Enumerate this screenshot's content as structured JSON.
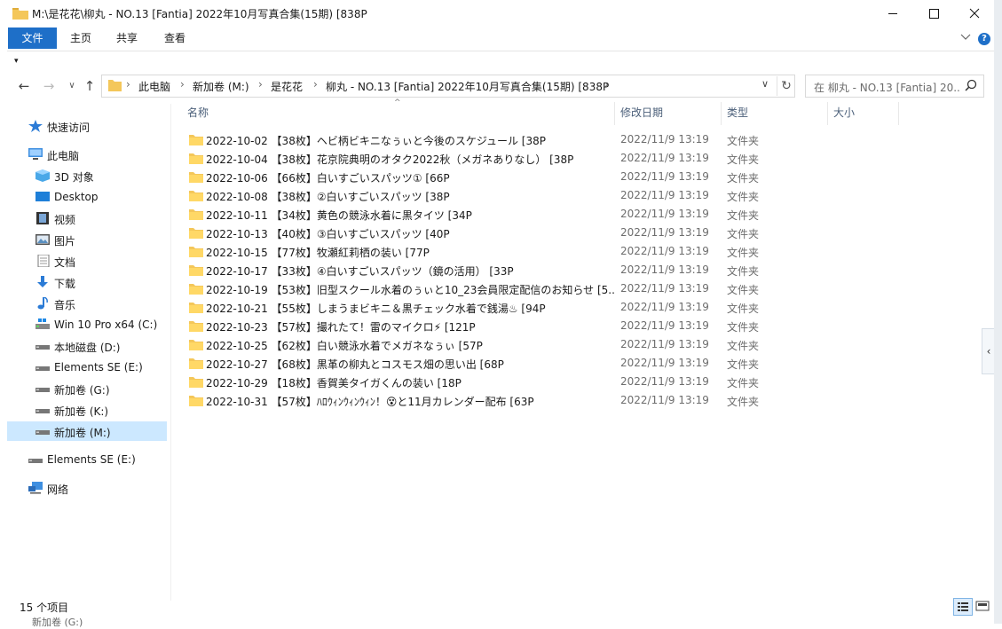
{
  "window": {
    "title": "M:\\是花花\\柳丸 - NO.13 [Fantia] 2022年10月写真合集(15期) [838P",
    "minimize_glyph": "─",
    "maximize_glyph": "☐",
    "close_glyph": "✕"
  },
  "ribbon": {
    "tabs": [
      "文件",
      "主页",
      "共享",
      "查看"
    ],
    "expand_glyph": "∨",
    "help_glyph": "?",
    "qat_glyph": "▾"
  },
  "nav": {
    "back_glyph": "←",
    "forward_glyph": "→",
    "recent_glyph": "∨",
    "up_glyph": "↑"
  },
  "address": {
    "crumbs": [
      "此电脑",
      "新加卷 (M:)",
      "是花花",
      "柳丸 - NO.13 [Fantia] 2022年10月写真合集(15期) [838P"
    ],
    "separator": "›",
    "dropdown_glyph": "∨",
    "refresh_glyph": "↻"
  },
  "search": {
    "placeholder": "在 柳丸 - NO.13 [Fantia] 20..."
  },
  "navpane": {
    "items": [
      {
        "label": "快速访问",
        "icon": "star-icon"
      },
      {
        "label": "此电脑",
        "icon": "computer-icon"
      },
      {
        "label": "3D 对象",
        "icon": "cube-icon"
      },
      {
        "label": "Desktop",
        "icon": "desktop-icon"
      },
      {
        "label": "视频",
        "icon": "video-icon"
      },
      {
        "label": "图片",
        "icon": "picture-icon"
      },
      {
        "label": "文档",
        "icon": "document-icon"
      },
      {
        "label": "下载",
        "icon": "download-icon"
      },
      {
        "label": "音乐",
        "icon": "music-icon"
      },
      {
        "label": "Win 10 Pro x64 (C:)",
        "icon": "system-drive-icon"
      },
      {
        "label": "本地磁盘 (D:)",
        "icon": "drive-icon"
      },
      {
        "label": "Elements SE (E:)",
        "icon": "drive-icon"
      },
      {
        "label": "新加卷 (G:)",
        "icon": "drive-icon"
      },
      {
        "label": "新加卷 (K:)",
        "icon": "drive-icon"
      },
      {
        "label": "新加卷 (M:)",
        "icon": "drive-icon",
        "selected": true
      },
      {
        "label": "Elements SE (E:)",
        "icon": "drive-icon"
      },
      {
        "label": "网络",
        "icon": "network-icon"
      }
    ]
  },
  "columns": {
    "name": "名称",
    "date": "修改日期",
    "type": "类型",
    "size": "大小",
    "sort_glyph": "^"
  },
  "files": [
    {
      "name": "2022-10-02 【38枚】ヘビ柄ビキニなぅぃと今後のスケジュール [38P",
      "date": "2022/11/9 13:19",
      "type": "文件夹"
    },
    {
      "name": "2022-10-04 【38枚】花京院典明のオタク2022秋（メガネありなし） [38P",
      "date": "2022/11/9 13:19",
      "type": "文件夹"
    },
    {
      "name": "2022-10-06 【66枚】白いすごいスパッツ① [66P",
      "date": "2022/11/9 13:19",
      "type": "文件夹"
    },
    {
      "name": "2022-10-08 【38枚】②白いすごいスパッツ [38P",
      "date": "2022/11/9 13:19",
      "type": "文件夹"
    },
    {
      "name": "2022-10-11 【34枚】黄色の競泳水着に黒タイツ [34P",
      "date": "2022/11/9 13:19",
      "type": "文件夹"
    },
    {
      "name": "2022-10-13 【40枚】③白いすごいスパッツ [40P",
      "date": "2022/11/9 13:19",
      "type": "文件夹"
    },
    {
      "name": "2022-10-15 【77枚】牧瀬紅莉栖の装い [77P",
      "date": "2022/11/9 13:19",
      "type": "文件夹"
    },
    {
      "name": "2022-10-17 【33枚】④白いすごいスパッツ（鏡の活用） [33P",
      "date": "2022/11/9 13:19",
      "type": "文件夹"
    },
    {
      "name": "2022-10-19 【53枚】旧型スクール水着のぅぃと10_23会員限定配信のお知らせ [5...",
      "date": "2022/11/9 13:19",
      "type": "文件夹"
    },
    {
      "name": "2022-10-21 【55枚】しまうまビキニ＆黒チェック水着で銭湯♨ [94P",
      "date": "2022/11/9 13:19",
      "type": "文件夹"
    },
    {
      "name": "2022-10-23 【57枚】撮れたて！雷のマイクロ⚡ [121P",
      "date": "2022/11/9 13:19",
      "type": "文件夹"
    },
    {
      "name": "2022-10-25 【62枚】白い競泳水着でメガネなぅぃ [57P",
      "date": "2022/11/9 13:19",
      "type": "文件夹"
    },
    {
      "name": "2022-10-27 【68枚】黒革の柳丸とコスモス畑の思い出 [68P",
      "date": "2022/11/9 13:19",
      "type": "文件夹"
    },
    {
      "name": "2022-10-29 【18枚】香賀美タイガくんの装い [18P",
      "date": "2022/11/9 13:19",
      "type": "文件夹"
    },
    {
      "name": "2022-10-31 【57枚】ﾊﾛｳｨﾝｳｨﾝｳｨﾝ！😵と11月カレンダー配布 [63P",
      "date": "2022/11/9 13:19",
      "type": "文件夹"
    }
  ],
  "status": {
    "count": "15 个项目"
  },
  "collapse_glyph": "‹",
  "ghost_text": "新加卷 (G:)",
  "colors": {
    "accent": "#1e6fc8",
    "folder": "#f4c75a",
    "selected": "#cce8ff"
  }
}
